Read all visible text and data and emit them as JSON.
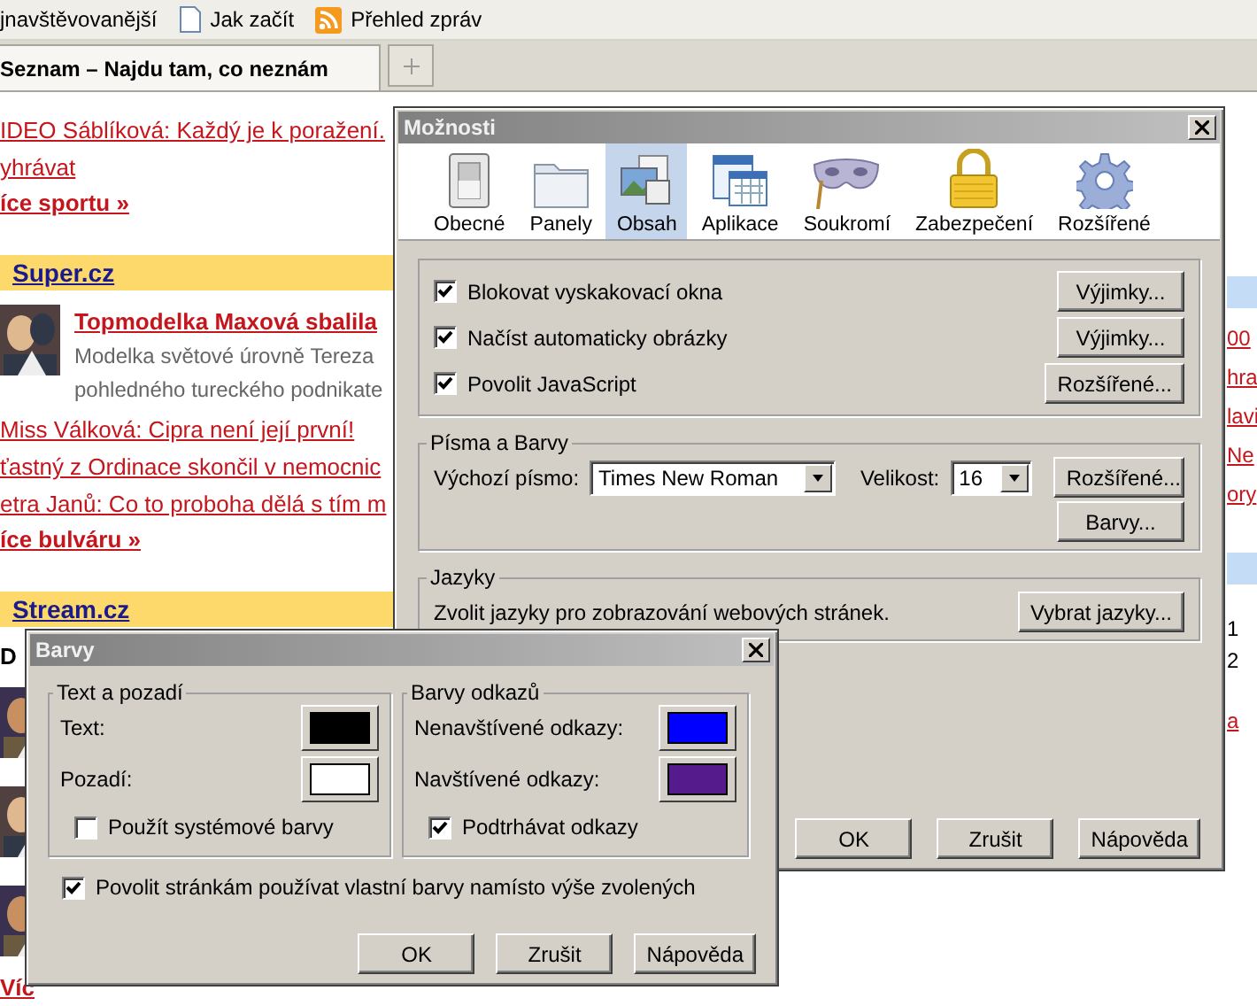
{
  "bookmarks_bar": {
    "items": [
      {
        "label": "jnavštěvovanější"
      },
      {
        "label": "Jak začít"
      },
      {
        "label": "Přehled zpráv"
      }
    ]
  },
  "tabs": [
    {
      "label": "Seznam – Najdu tam, co neznám",
      "selected": true
    }
  ],
  "page": {
    "left_column": [
      {
        "kind": "link",
        "text": "IDEO Sáblíková: Každý je k poražení."
      },
      {
        "kind": "link",
        "text": "yhrávat"
      },
      {
        "kind": "more",
        "text": "íce sportu »"
      },
      {
        "kind": "header",
        "text": "Super.cz"
      },
      {
        "kind": "feature",
        "title": "Topmodelka Maxová sbalila",
        "lines": [
          "Modelka světové úrovně Tereza",
          "pohledného tureckého podnikate"
        ]
      },
      {
        "kind": "link",
        "text": "Miss Válková: Cipra není její první!"
      },
      {
        "kind": "link",
        "text": "ťastný z Ordinace skončil v nemocnic"
      },
      {
        "kind": "link",
        "text": "etra Janů: Co to proboha dělá s tím m"
      },
      {
        "kind": "more",
        "text": "íce bulváru »"
      },
      {
        "kind": "header",
        "text": "Stream.cz"
      },
      {
        "kind": "plain",
        "text": "D"
      },
      {
        "kind": "video"
      },
      {
        "kind": "video"
      },
      {
        "kind": "video"
      },
      {
        "kind": "more",
        "text": "Víc"
      }
    ],
    "right_column": [
      {
        "kind": "band"
      },
      {
        "kind": "link",
        "text": "00"
      },
      {
        "kind": "link",
        "text": "hra"
      },
      {
        "kind": "link",
        "text": "lavi"
      },
      {
        "kind": "link",
        "text": "Ne"
      },
      {
        "kind": "link",
        "text": "ory"
      },
      {
        "kind": "band"
      },
      {
        "kind": "plain",
        "text": "1"
      },
      {
        "kind": "plain",
        "text": "2"
      },
      {
        "kind": "link",
        "text": "a"
      }
    ]
  },
  "options_dialog": {
    "title": "Možnosti",
    "panes": [
      {
        "label": "Obecné",
        "selected": false
      },
      {
        "label": "Panely",
        "selected": false
      },
      {
        "label": "Obsah",
        "selected": true
      },
      {
        "label": "Aplikace",
        "selected": false
      },
      {
        "label": "Soukromí",
        "selected": false
      },
      {
        "label": "Zabezpečení",
        "selected": false
      },
      {
        "label": "Rozšířené",
        "selected": false
      }
    ],
    "content_options": [
      {
        "label": "Blokovat vyskakovací okna",
        "checked": true,
        "button": "Výjimky..."
      },
      {
        "label": "Načíst automaticky obrázky",
        "checked": true,
        "button": "Výjimky..."
      },
      {
        "label": "Povolit JavaScript",
        "checked": true,
        "button": "Rozšířené..."
      }
    ],
    "fonts_group": {
      "title": "Písma a Barvy",
      "font_label": "Výchozí písmo:",
      "font_value": "Times New Roman",
      "size_label": "Velikost:",
      "size_value": "16",
      "advanced_button": "Rozšířené...",
      "colors_button": "Barvy..."
    },
    "languages_group": {
      "title": "Jazyky",
      "text": "Zvolit jazyky pro zobrazování webových stránek.",
      "button": "Vybrat jazyky..."
    },
    "buttons": [
      "OK",
      "Zrušit",
      "Nápověda"
    ]
  },
  "colors_dialog": {
    "title": "Barvy",
    "text_group": {
      "title": "Text a pozadí",
      "swatches": [
        {
          "label": "Text:",
          "color": "#000000"
        },
        {
          "label": "Pozadí:",
          "color": "#ffffff"
        }
      ],
      "system_colors": {
        "label": "Použít systémové barvy",
        "checked": false
      }
    },
    "links_group": {
      "title": "Barvy odkazů",
      "swatches": [
        {
          "label": "Nenavštívené odkazy:",
          "color": "#0000ff"
        },
        {
          "label": "Navštívené odkazy:",
          "color": "#551a8b"
        }
      ],
      "underline": {
        "label": "Podtrhávat odkazy",
        "checked": true
      }
    },
    "allow_page_colors": {
      "label": "Povolit stránkám používat vlastní barvy namísto výše zvolených",
      "checked": true
    },
    "buttons": [
      "OK",
      "Zrušit",
      "Nápověda"
    ]
  }
}
